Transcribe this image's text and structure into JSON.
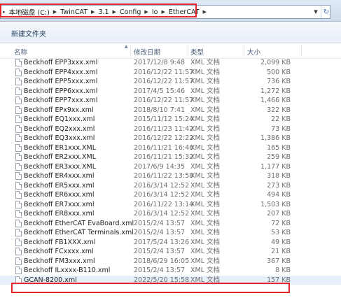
{
  "address": {
    "crumbs": [
      "本地磁盘 (C:)",
      "TwinCAT",
      "3.1",
      "Config",
      "Io",
      "EtherCAT"
    ],
    "dropdown_icon": "chevron-down-icon",
    "refresh_icon": "refresh-icon"
  },
  "toolbar": {
    "new_folder_label": "新建文件夹"
  },
  "columns": {
    "name": "名称",
    "date": "修改日期",
    "type": "类型",
    "size": "大小"
  },
  "files": [
    {
      "name": "Beckhoff EPP3xxx.xml",
      "date": "2017/12/8 9:48",
      "type": "XML 文档",
      "size": "2,099 KB"
    },
    {
      "name": "Beckhoff EPP4xxx.xml",
      "date": "2016/12/22 11:57",
      "type": "XML 文档",
      "size": "500 KB"
    },
    {
      "name": "Beckhoff EPP5xxx.xml",
      "date": "2016/12/22 11:57",
      "type": "XML 文档",
      "size": "736 KB"
    },
    {
      "name": "Beckhoff EPP6xxx.xml",
      "date": "2017/4/5 15:46",
      "type": "XML 文档",
      "size": "1,272 KB"
    },
    {
      "name": "Beckhoff EPP7xxx.xml",
      "date": "2016/12/22 11:57",
      "type": "XML 文档",
      "size": "1,466 KB"
    },
    {
      "name": "Beckhoff EPx9xx.xml",
      "date": "2018/8/10 7:41",
      "type": "XML 文档",
      "size": "322 KB"
    },
    {
      "name": "Beckhoff EQ1xxx.xml",
      "date": "2015/11/12 15:24",
      "type": "XML 文档",
      "size": "22 KB"
    },
    {
      "name": "Beckhoff EQ2xxx.xml",
      "date": "2016/11/23 11:42",
      "type": "XML 文档",
      "size": "73 KB"
    },
    {
      "name": "Beckhoff EQ3xxx.xml",
      "date": "2016/12/22 12:22",
      "type": "XML 文档",
      "size": "1,386 KB"
    },
    {
      "name": "Beckhoff ER1xxx.XML",
      "date": "2016/11/21 16:46",
      "type": "XML 文档",
      "size": "165 KB"
    },
    {
      "name": "Beckhoff ER2xxx.XML",
      "date": "2016/11/21 15:32",
      "type": "XML 文档",
      "size": "259 KB"
    },
    {
      "name": "Beckhoff ER3xxx.XML",
      "date": "2017/6/9 14:35",
      "type": "XML 文档",
      "size": "1,177 KB"
    },
    {
      "name": "Beckhoff ER4xxx.xml",
      "date": "2016/11/22 13:58",
      "type": "XML 文档",
      "size": "318 KB"
    },
    {
      "name": "Beckhoff ER5xxx.xml",
      "date": "2016/3/14 12:52",
      "type": "XML 文档",
      "size": "273 KB"
    },
    {
      "name": "Beckhoff ER6xxx.xml",
      "date": "2016/3/14 12:52",
      "type": "XML 文档",
      "size": "494 KB"
    },
    {
      "name": "Beckhoff ER7xxx.xml",
      "date": "2016/11/22 13:14",
      "type": "XML 文档",
      "size": "1,503 KB"
    },
    {
      "name": "Beckhoff ER8xxx.xml",
      "date": "2016/3/14 12:52",
      "type": "XML 文档",
      "size": "207 KB"
    },
    {
      "name": "Beckhoff EtherCAT EvaBoard.xml",
      "date": "2015/2/4 13:57",
      "type": "XML 文档",
      "size": "72 KB"
    },
    {
      "name": "Beckhoff EtherCAT Terminals.xml",
      "date": "2015/2/4 13:57",
      "type": "XML 文档",
      "size": "53 KB"
    },
    {
      "name": "Beckhoff FB1XXX.xml",
      "date": "2017/5/24 13:26",
      "type": "XML 文档",
      "size": "49 KB"
    },
    {
      "name": "Beckhoff FCxxxx.xml",
      "date": "2015/2/4 13:57",
      "type": "XML 文档",
      "size": "21 KB"
    },
    {
      "name": "Beckhoff FM3xxx.xml",
      "date": "2018/6/29 16:05",
      "type": "XML 文档",
      "size": "367 KB"
    },
    {
      "name": "Beckhoff ILxxxx-B110.xml",
      "date": "2015/2/4 13:57",
      "type": "XML 文档",
      "size": "8 KB"
    },
    {
      "name": "GCAN-8200.xml",
      "date": "2022/5/20 15:58",
      "type": "XML 文档",
      "size": "157 KB",
      "selected": true
    }
  ],
  "colors": {
    "highlight": "#e3262b",
    "selection": "#e6f0fb"
  }
}
